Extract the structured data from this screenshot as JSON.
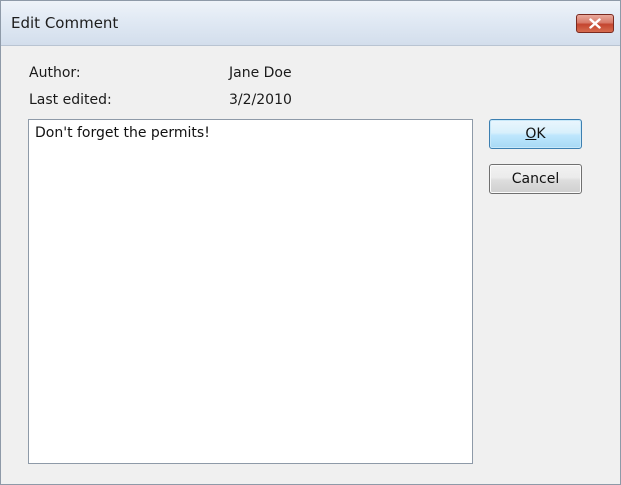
{
  "window": {
    "title": "Edit Comment"
  },
  "close_button": {
    "icon": "close-icon",
    "color": "#c4452f"
  },
  "fields": {
    "author_label": "Author:",
    "author_value": "Jane Doe",
    "last_edited_label": "Last edited:",
    "last_edited_value": "3/2/2010"
  },
  "comment": {
    "text": "Don't forget the permits!"
  },
  "buttons": {
    "ok_mnemonic": "O",
    "ok_rest": "K",
    "cancel_label": "Cancel"
  },
  "colors": {
    "default_button_border": "#3c7fb1",
    "dialog_background": "#f0f0f0"
  }
}
